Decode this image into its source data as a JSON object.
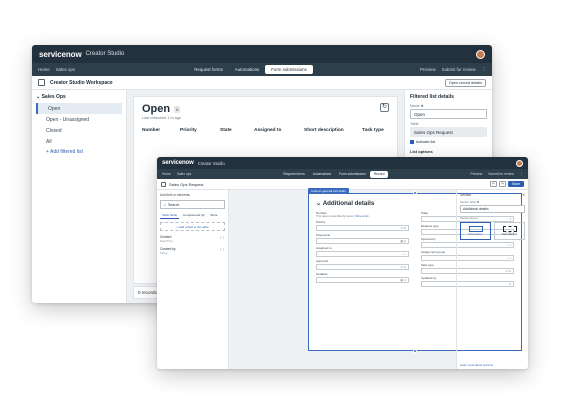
{
  "back": {
    "brand": "servicenow",
    "brand_sub": "Creator Studio",
    "crumbs": [
      "Home",
      "Sales ops"
    ],
    "tabs": [
      "Request forms",
      "Automations",
      "Form submissions"
    ],
    "tab_counts": [
      "",
      "",
      ""
    ],
    "nav_right": [
      "Preview",
      "Submit for review",
      "⋮"
    ],
    "workspace_title": "Creator Studio Workspace",
    "open_record_details": "Open record details",
    "sidebar": {
      "group": "Sales Ops",
      "items": [
        "Open",
        "Open - Unassigned",
        "Closed",
        "All"
      ],
      "add": "Add filtered list"
    },
    "list": {
      "title": "Open",
      "count": "0",
      "refreshed": "Last refreshed 1 m ago",
      "columns": [
        "Number",
        "Priority",
        "State",
        "Assigned to",
        "Short description",
        "Task type"
      ],
      "footer": "0 records"
    },
    "details": {
      "title": "Filtered list details",
      "name_label": "Name ✱",
      "name_value": "Open",
      "table_label": "Table",
      "table_value": "Sales Ops Request",
      "activate": "Activate list",
      "options": "List options"
    }
  },
  "front": {
    "brand": "servicenow",
    "brand_sub": "Creator Studio",
    "crumbs": [
      "Home",
      "Sales ops"
    ],
    "tabs": [
      "Request forms",
      "Automations",
      "Form submissions",
      "Record"
    ],
    "nav_right": [
      "Preview",
      "Submit for review",
      "⋮"
    ],
    "record_title": "Sales Ops Request",
    "save": "Save",
    "left": {
      "title": "Add field or elements",
      "search": "Search",
      "tabs": [
        "Table fields",
        "Components (4)",
        "More"
      ],
      "add_field": "+ Add a field to the table",
      "items": [
        {
          "name": "Created",
          "sub": "Date/Time"
        },
        {
          "name": "Created by",
          "sub": "String"
        }
      ]
    },
    "form": {
      "badge": "Column general info fields",
      "section_title": "Additional details",
      "fields_left": [
        {
          "label": "Number",
          "help": "This value is auto-filled by server.",
          "link": "Show script"
        },
        {
          "label": "Priority",
          "value": ""
        },
        {
          "label": "Opened at",
          "value": ""
        },
        {
          "label": "Assigned to",
          "value": ""
        },
        {
          "label": "Approval",
          "value": ""
        },
        {
          "label": "Updated",
          "value": ""
        }
      ],
      "fields_right": [
        {
          "label": "State",
          "value": ""
        },
        {
          "label": "Request type",
          "value": ""
        },
        {
          "label": "Opened by",
          "value": ""
        },
        {
          "label": "Assignment group",
          "value": ""
        },
        {
          "label": "Task type",
          "value": ""
        },
        {
          "label": "Updated by",
          "value": ""
        }
      ]
    },
    "right": {
      "title": "Section",
      "label_label": "Section label ✱",
      "label_value": "Additional details",
      "layout_label": "Section layout",
      "layouts": [
        "One column",
        "Two columns"
      ],
      "learn": "Learn more about sections"
    }
  },
  "colors": {
    "topbar": "#22313d",
    "accent": "#2f5fb3",
    "canvas": "#eef1f4"
  }
}
